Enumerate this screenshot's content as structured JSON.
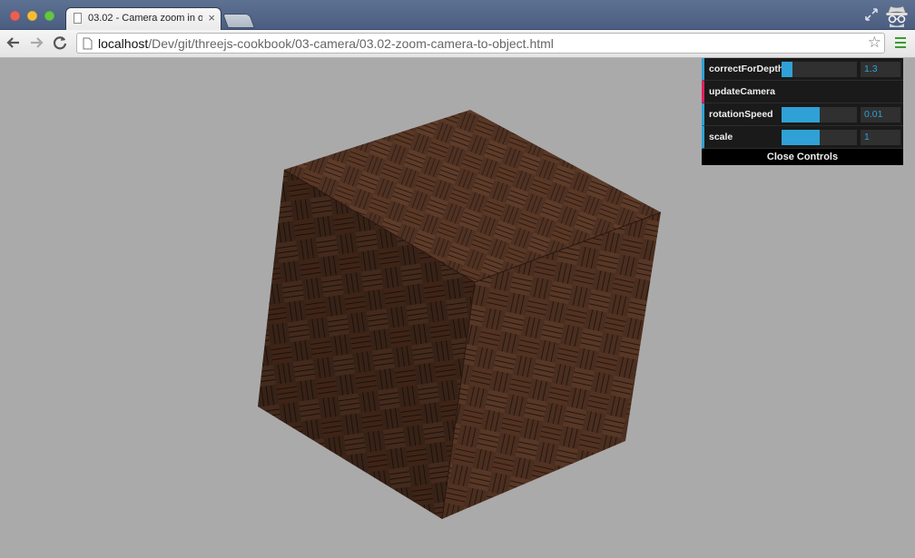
{
  "browser": {
    "tab_title": "03.02 - Camera zoom in o",
    "url_host": "localhost",
    "url_path": "/Dev/git/threejs-cookbook/03-camera/03.02-zoom-camera-to-object.html",
    "icons": [
      "back-icon",
      "forward-icon",
      "reload-icon",
      "page-icon",
      "bookmark-star-icon",
      "menu-icon",
      "incognito-icon",
      "fullscreen-icon",
      "close-tab-icon"
    ]
  },
  "gui": {
    "controls": [
      {
        "label": "correctForDepth",
        "value": "1.3",
        "fill": 0.14,
        "type": "slider"
      },
      {
        "label": "updateCamera",
        "type": "function"
      },
      {
        "label": "rotationSpeed",
        "value": "0.01",
        "fill": 0.51,
        "type": "slider"
      },
      {
        "label": "scale",
        "value": "1",
        "fill": 0.5,
        "type": "slider"
      }
    ],
    "close_label": "Close Controls",
    "accent_color": "#2fa1d6",
    "function_color": "#e61d5f"
  },
  "scene": {
    "background": "#aaaaaa",
    "object": "wood-parquet-textured-cube"
  }
}
